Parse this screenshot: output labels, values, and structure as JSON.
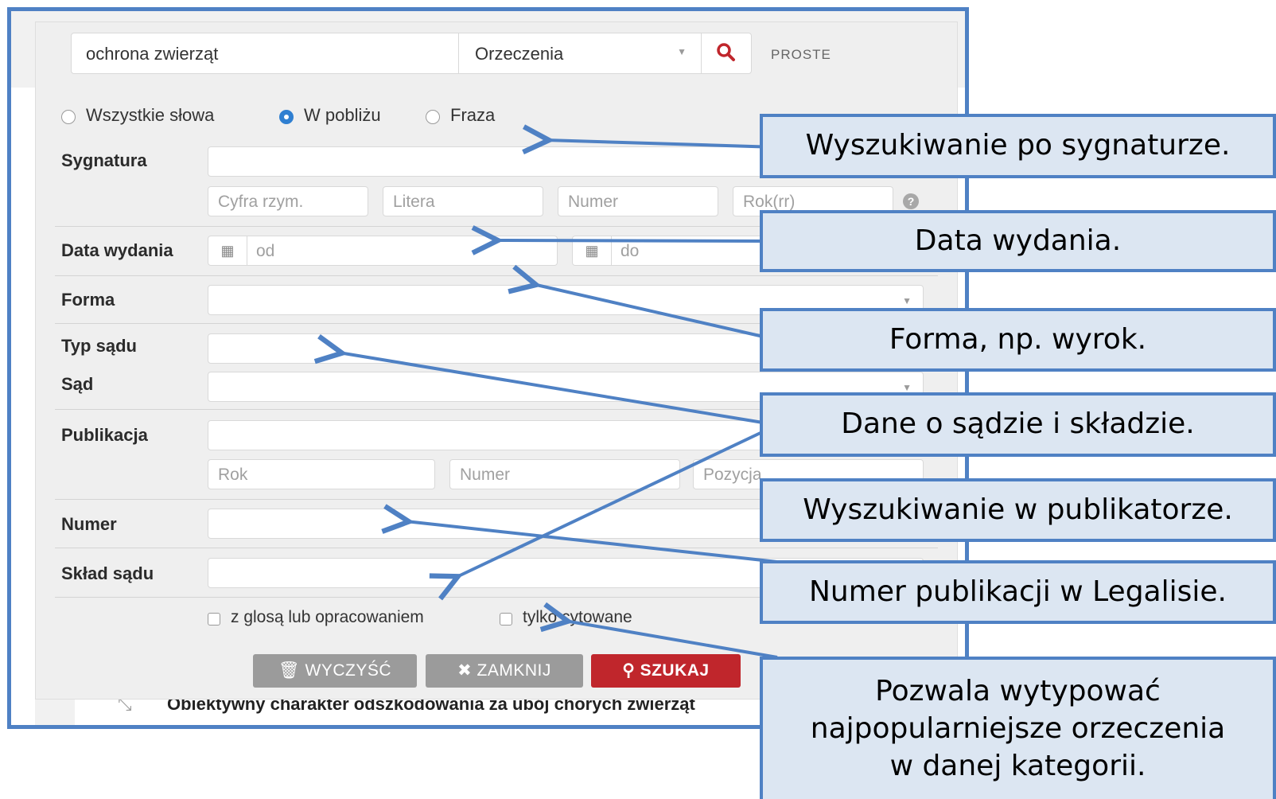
{
  "search": {
    "query": "ochrona zwierząt",
    "category": "Orzeczenia",
    "mode_link": "PROSTE"
  },
  "options": {
    "all_words": "Wszystkie słowa",
    "nearby": "W pobliżu",
    "phrase": "Fraza"
  },
  "labels": {
    "signature": "Sygnatura",
    "date": "Data wydania",
    "form": "Forma",
    "court_type": "Typ sądu",
    "court": "Sąd",
    "publication": "Publikacja",
    "number": "Numer",
    "bench": "Skład sądu"
  },
  "placeholders": {
    "roman": "Cyfra rzym.",
    "letter": "Litera",
    "number": "Numer",
    "year_short": "Rok(rr)",
    "date_from": "od",
    "date_to": "do",
    "pub_year": "Rok",
    "pub_number": "Numer",
    "pub_position": "Pozycja"
  },
  "checkboxes": {
    "with_gloss": "z glosą lub opracowaniem",
    "only_cited": "tylko cytowane"
  },
  "buttons": {
    "clear": "WYCZYŚĆ",
    "close": "ZAMKNIJ",
    "search": "SZUKAJ"
  },
  "result_title": "Obiektywny charakter odszkodowania za ubój chorych zwierząt",
  "callouts": {
    "signature": "Wyszukiwanie po sygnaturze.",
    "date": "Data wydania.",
    "form": "Forma, np. wyrok.",
    "court": "Dane o sądzie i składzie.",
    "publication": "Wyszukiwanie w publikatorze.",
    "number": "Numer publikacji w Legalisie.",
    "popular_line1": "Pozwala wytypować",
    "popular_line2": "najpopularniejsze orzeczenia",
    "popular_line3": "w danej kategorii."
  },
  "colors": {
    "accent_blue": "#4f81c4",
    "callout_fill": "#dce6f2",
    "search_red": "#c0262c",
    "button_gray": "#9b9b9b"
  }
}
